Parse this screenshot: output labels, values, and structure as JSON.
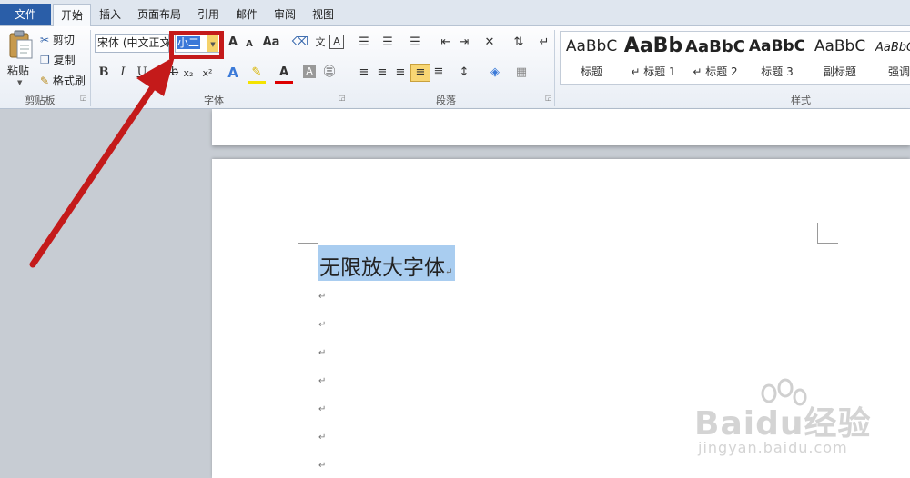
{
  "tabs": {
    "file": "文件",
    "items": [
      "开始",
      "插入",
      "页面布局",
      "引用",
      "邮件",
      "审阅",
      "视图"
    ]
  },
  "clipboard": {
    "paste": "粘贴",
    "cut": "剪切",
    "copy": "复制",
    "format_painter": "格式刷",
    "group": "剪贴板"
  },
  "font": {
    "name": "宋体 (中文正文",
    "size": "小二",
    "group": "字体",
    "bold": "B",
    "italic": "I",
    "underline": "U",
    "change_case": "Aa",
    "grow": "A",
    "shrink": "A",
    "subscript": "x₂",
    "superscript": "x²"
  },
  "paragraph": {
    "group": "段落"
  },
  "styles": {
    "group": "样式",
    "items": [
      {
        "preview": "AaBbC",
        "name": "标题"
      },
      {
        "preview": "AaBb",
        "name": "↵ 标题 1"
      },
      {
        "preview": "AaBbC",
        "name": "↵ 标题 2"
      },
      {
        "preview": "AaBbC",
        "name": "标题 3"
      },
      {
        "preview": "AaBbC",
        "name": "副标题"
      },
      {
        "preview": "AaBbC",
        "name": "强调"
      }
    ]
  },
  "document": {
    "selected_text": "无限放大字体",
    "paragraph_mark": "↵"
  },
  "watermark": {
    "brand": "Baidu经验",
    "url": "jingyan.baidu.com"
  },
  "colors": {
    "file_tab": "#2a5ea8",
    "selection": "#a9cdf0",
    "highlight": "#c41a1a"
  }
}
